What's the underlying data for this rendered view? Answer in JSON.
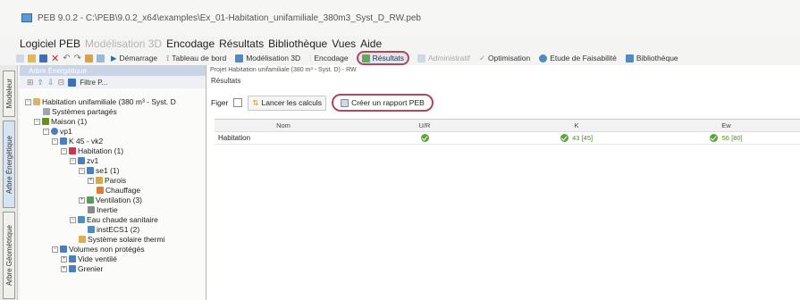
{
  "window": {
    "title": "PEB 9.0.2 - C:\\PEB\\9.0.2_x64\\examples\\Ex_01-Habitation_unifamiliale_380m3_Syst_D_RW.peb"
  },
  "menu": [
    {
      "label": "Logiciel PEB",
      "enabled": true
    },
    {
      "label": "Modélisation 3D",
      "enabled": false
    },
    {
      "label": "Encodage",
      "enabled": true
    },
    {
      "label": "Résultats",
      "enabled": true
    },
    {
      "label": "Bibliothèque",
      "enabled": true
    },
    {
      "label": "Vues",
      "enabled": true
    },
    {
      "label": "Aide",
      "enabled": true
    }
  ],
  "toolbar": {
    "demarrage": "Démarrage",
    "tableau": "Tableau de bord",
    "modelisation": "Modélisation 3D",
    "encodage": "Encodage",
    "resultats": "Résultats",
    "administratif": "Administratif",
    "optimisation": "Optimisation",
    "faisabilite": "Etude de Faisabilité",
    "bibliotheque": "Bibliothèque"
  },
  "side_tabs": {
    "modeler": "Modeleur",
    "energetique": "Arbre Énergétique",
    "geometrique": "Arbre Géométrique"
  },
  "tree": {
    "header": "Arbre Énergétique",
    "filter": "Filtre P...",
    "items": [
      {
        "label": "Habitation unifamiliale (380 m³ - Syst. D",
        "color": "#d9b46a"
      },
      {
        "label": "Systèmes partagés",
        "color": "#9aa7b5"
      },
      {
        "label": "Maison (1)",
        "color": "#6b8e23"
      },
      {
        "label": "vp1",
        "color": "#4a7fbf"
      },
      {
        "label": "K 45 - vk2",
        "color": "#4a7fbf"
      },
      {
        "label": "Habitation (1)",
        "color": "#c9384a"
      },
      {
        "label": "zv1",
        "color": "#4a7fbf"
      },
      {
        "label": "se1 (1)",
        "color": "#4a7fbf"
      },
      {
        "label": "Parois",
        "color": "#d9a84a"
      },
      {
        "label": "Chauffage",
        "color": "#e07b39"
      },
      {
        "label": "Ventilation (3)",
        "color": "#5a9a5a"
      },
      {
        "label": "Inertie",
        "color": "#8a8a8a"
      },
      {
        "label": "Eau chaude sanitaire",
        "color": "#4a8fbf"
      },
      {
        "label": "instECS1 (2)",
        "color": "#4a8fbf"
      },
      {
        "label": "Système solaire thermi",
        "color": "#d9b04a"
      },
      {
        "label": "Volumes non protégés",
        "color": "#4a7fbf"
      },
      {
        "label": "Vide ventilé",
        "color": "#4a7fbf"
      },
      {
        "label": "Grenier",
        "color": "#4a7fbf"
      }
    ]
  },
  "main": {
    "breadcrumb": "Projet Habitation unifamiliale (380 m³ - Syst. D) - RW",
    "section": "Résultats",
    "figer": "Figer",
    "lancer": "Lancer les calculs",
    "rapport": "Créer un rapport PEB",
    "columns": [
      "Nom",
      "U/R",
      "K",
      "Ew"
    ],
    "rows": [
      {
        "name": "Habitation",
        "k": "43 [45]",
        "ew": "56 [80]"
      }
    ]
  },
  "colors": {
    "highlight": "#b0485b",
    "ok": "#5aa43a"
  }
}
